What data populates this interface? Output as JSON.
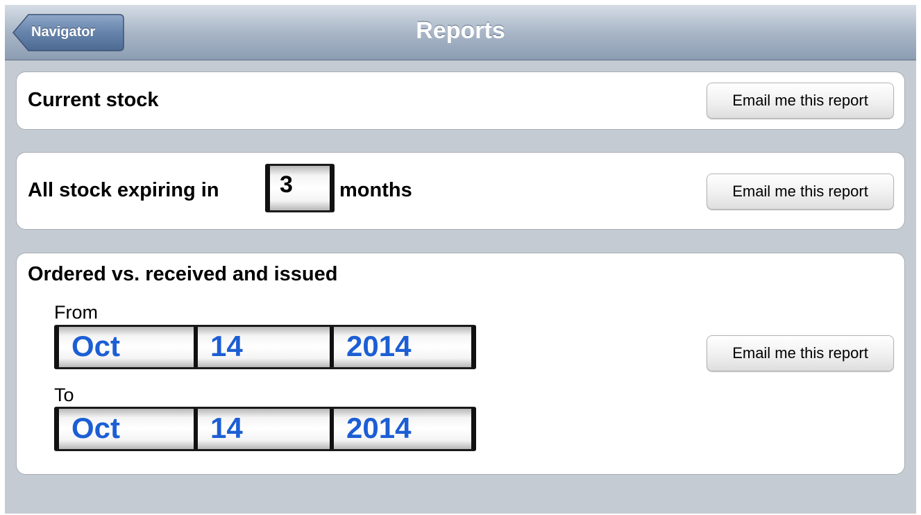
{
  "nav": {
    "back_label": "Navigator",
    "title": "Reports"
  },
  "reports": {
    "current_stock": {
      "title": "Current stock",
      "button": "Email me this report"
    },
    "expiring": {
      "prefix": "All stock expiring in",
      "months_value": "3",
      "suffix": "months",
      "button": "Email me this report"
    },
    "ordered": {
      "title": "Ordered vs. received and issued",
      "from_label": "From",
      "from": {
        "month": "Oct",
        "day": "14",
        "year": "2014"
      },
      "to_label": "To",
      "to": {
        "month": "Oct",
        "day": "14",
        "year": "2014"
      },
      "button": "Email me this report"
    }
  },
  "colors": {
    "background": "#c5cbd3",
    "date_value": "#1c5ed4",
    "nav_gradient_top": "#d6dde6",
    "nav_gradient_bottom": "#8c9db3"
  }
}
